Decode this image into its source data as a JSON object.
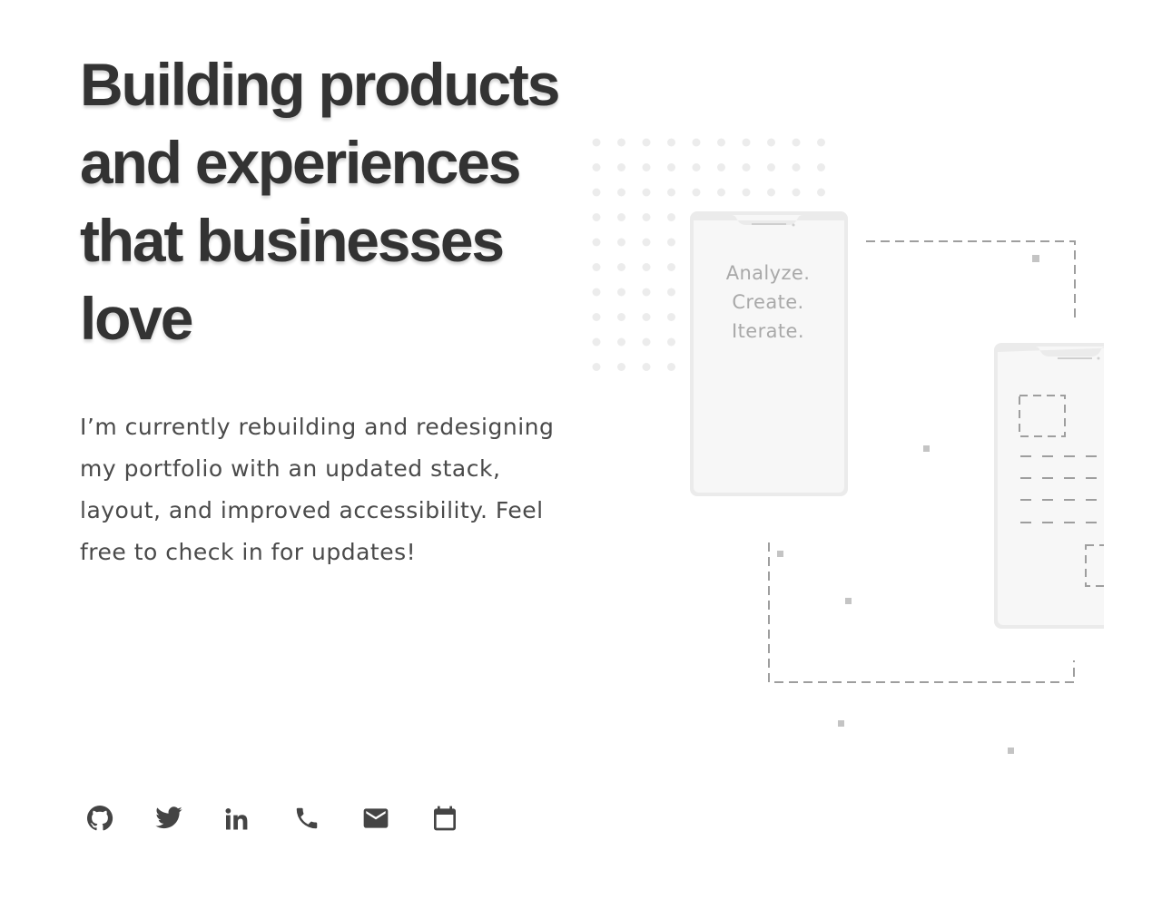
{
  "hero": {
    "title_lines": [
      "Building products",
      "and experiences",
      "that businesses",
      "love"
    ],
    "description": "I’m currently rebuilding and redesigning my portfolio with an updated stack, layout, and improved accessibility. Feel free to check in for updates!"
  },
  "social": [
    {
      "name": "github",
      "icon": "github-icon"
    },
    {
      "name": "twitter",
      "icon": "twitter-icon"
    },
    {
      "name": "linkedin",
      "icon": "linkedin-icon"
    },
    {
      "name": "phone",
      "icon": "phone-icon"
    },
    {
      "name": "email",
      "icon": "mail-icon"
    },
    {
      "name": "calendar",
      "icon": "calendar-icon"
    }
  ],
  "illustration": {
    "phone_text": [
      "Analyze.",
      "Create.",
      "Iterate."
    ]
  },
  "colors": {
    "heading": "#333333",
    "body_text": "#4a4a4a",
    "icon": "#444444",
    "illustration_stroke": "#9e9e9e",
    "illustration_fill": "#f6f6f6"
  }
}
